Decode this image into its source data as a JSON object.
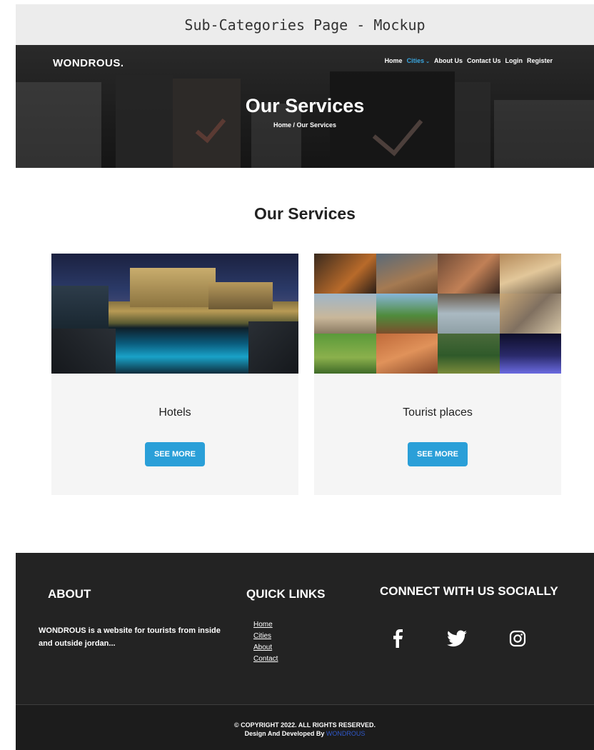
{
  "mockup": {
    "title": "Sub-Categories Page - Mockup"
  },
  "header": {
    "logo": "WONDROUS.",
    "nav": [
      {
        "label": "Home"
      },
      {
        "label": "Cities",
        "active": true,
        "has_dropdown": true
      },
      {
        "label": "About Us"
      },
      {
        "label": "Contact Us"
      },
      {
        "label": "Login"
      },
      {
        "label": "Register"
      }
    ],
    "hero_title": "Our Services",
    "breadcrumb": "Home / Our Services"
  },
  "main": {
    "section_title": "Our Services",
    "cards": [
      {
        "label": "Hotels",
        "button": "SEE MORE",
        "image": "hotel-night-pool-photo"
      },
      {
        "label": "Tourist places",
        "button": "SEE MORE",
        "image": "tourist-places-collage"
      }
    ]
  },
  "footer": {
    "about_heading": "ABOUT",
    "about_text": "WONDROUS is a website for tourists from inside and outside jordan...",
    "links_heading": "QUICK LINKS",
    "links": [
      "Home",
      "Cities",
      "About",
      "Contact"
    ],
    "social_heading": "CONNECT WITH US SOCIALLY",
    "social_icons": [
      "facebook-icon",
      "twitter-icon",
      "instagram-icon"
    ],
    "copyright": "© COPYRIGHT 2022. ALL RIGHTS RESERVED.",
    "credit_prefix": "Design And Developed By",
    "credit_link": "WONDROUS"
  },
  "colors": {
    "accent": "#2a9fd8",
    "nav_active": "#3aa7e0",
    "footer_bg": "#232323",
    "card_bg": "#f5f5f5"
  }
}
